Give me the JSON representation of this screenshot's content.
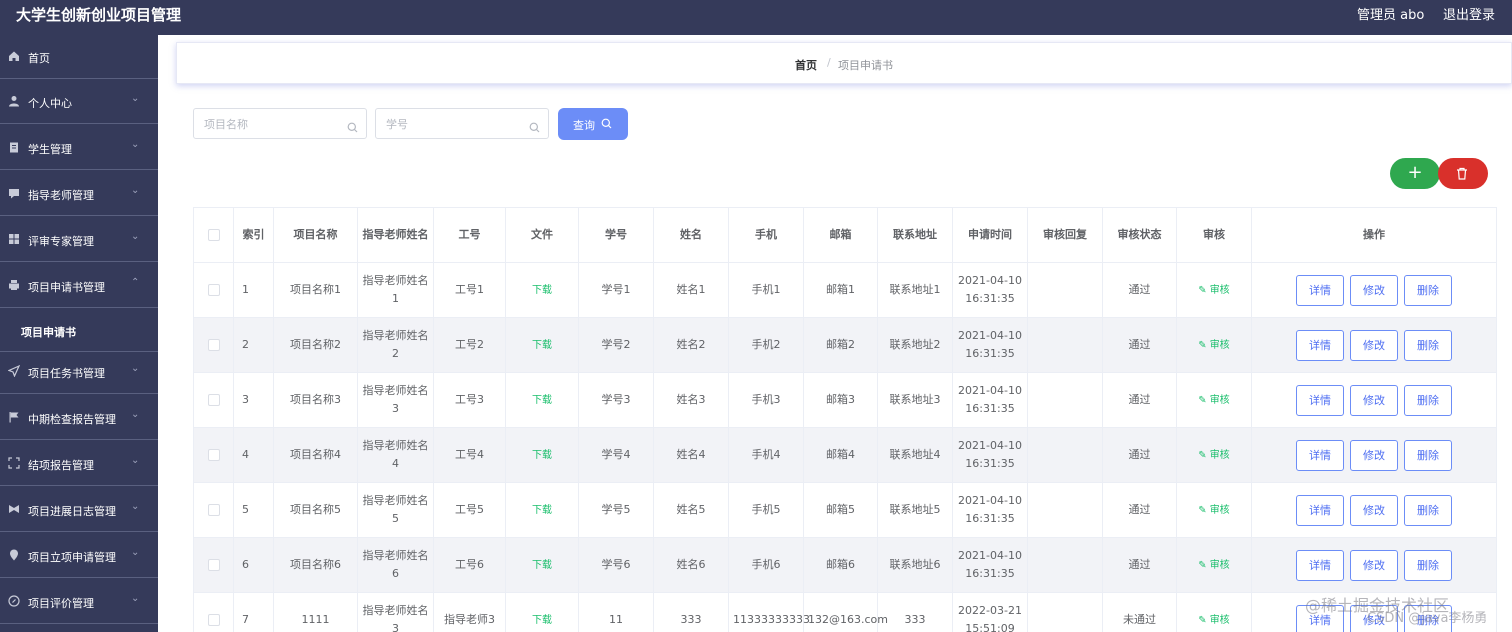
{
  "header": {
    "app_title": "大学生创新创业项目管理",
    "admin_label": "管理员 abo",
    "logout_label": "退出登录"
  },
  "sidebar": {
    "items": [
      {
        "label": "首页",
        "icon": "home-icon"
      },
      {
        "label": "个人中心",
        "icon": "user-icon"
      },
      {
        "label": "学生管理",
        "icon": "clipboard-icon"
      },
      {
        "label": "指导老师管理",
        "icon": "chat-icon"
      },
      {
        "label": "评审专家管理",
        "icon": "grid-icon"
      },
      {
        "label": "项目申请书管理",
        "icon": "printer-icon"
      },
      {
        "label": "项目申请书",
        "icon": ""
      },
      {
        "label": "项目任务书管理",
        "icon": "send-icon"
      },
      {
        "label": "中期检查报告管理",
        "icon": "flag-icon"
      },
      {
        "label": "结项报告管理",
        "icon": "frame-icon"
      },
      {
        "label": "项目进展日志管理",
        "icon": "bow-icon"
      },
      {
        "label": "项目立项申请管理",
        "icon": "location-icon"
      },
      {
        "label": "项目评价管理",
        "icon": "compass-icon"
      }
    ]
  },
  "breadcrumb": {
    "home": "首页",
    "separator": "/",
    "current": "项目申请书"
  },
  "search": {
    "project_name_placeholder": "项目名称",
    "student_id_placeholder": "学号",
    "query_label": "查询"
  },
  "actions": {
    "add_label": "+"
  },
  "table": {
    "headers": [
      "索引",
      "项目名称",
      "指导老师姓名",
      "工号",
      "文件",
      "学号",
      "姓名",
      "手机",
      "邮箱",
      "联系地址",
      "申请时间",
      "审核回复",
      "审核状态",
      "审核",
      "操作"
    ],
    "rows": [
      {
        "index": "1",
        "project": "项目名称1",
        "teacher": "指导老师姓名1",
        "job_no": "工号1",
        "file": "下载",
        "student_id": "学号1",
        "name": "姓名1",
        "phone": "手机1",
        "email": "邮箱1",
        "address": "联系地址1",
        "apply_time": "2021-04-10 16:31:35",
        "reply": "",
        "status": "通过",
        "audit": "审核"
      },
      {
        "index": "2",
        "project": "项目名称2",
        "teacher": "指导老师姓名2",
        "job_no": "工号2",
        "file": "下载",
        "student_id": "学号2",
        "name": "姓名2",
        "phone": "手机2",
        "email": "邮箱2",
        "address": "联系地址2",
        "apply_time": "2021-04-10 16:31:35",
        "reply": "",
        "status": "通过",
        "audit": "审核"
      },
      {
        "index": "3",
        "project": "项目名称3",
        "teacher": "指导老师姓名3",
        "job_no": "工号3",
        "file": "下载",
        "student_id": "学号3",
        "name": "姓名3",
        "phone": "手机3",
        "email": "邮箱3",
        "address": "联系地址3",
        "apply_time": "2021-04-10 16:31:35",
        "reply": "",
        "status": "通过",
        "audit": "审核"
      },
      {
        "index": "4",
        "project": "项目名称4",
        "teacher": "指导老师姓名4",
        "job_no": "工号4",
        "file": "下载",
        "student_id": "学号4",
        "name": "姓名4",
        "phone": "手机4",
        "email": "邮箱4",
        "address": "联系地址4",
        "apply_time": "2021-04-10 16:31:35",
        "reply": "",
        "status": "通过",
        "audit": "审核"
      },
      {
        "index": "5",
        "project": "项目名称5",
        "teacher": "指导老师姓名5",
        "job_no": "工号5",
        "file": "下载",
        "student_id": "学号5",
        "name": "姓名5",
        "phone": "手机5",
        "email": "邮箱5",
        "address": "联系地址5",
        "apply_time": "2021-04-10 16:31:35",
        "reply": "",
        "status": "通过",
        "audit": "审核"
      },
      {
        "index": "6",
        "project": "项目名称6",
        "teacher": "指导老师姓名6",
        "job_no": "工号6",
        "file": "下载",
        "student_id": "学号6",
        "name": "姓名6",
        "phone": "手机6",
        "email": "邮箱6",
        "address": "联系地址6",
        "apply_time": "2021-04-10 16:31:35",
        "reply": "",
        "status": "通过",
        "audit": "审核"
      },
      {
        "index": "7",
        "project": "1111",
        "teacher": "指导老师姓名3",
        "job_no": "指导老师3",
        "file": "下载",
        "student_id": "11",
        "name": "333",
        "phone": "11333333333",
        "email": "132@163.com",
        "address": "333",
        "apply_time": "2022-03-21 15:51:09",
        "reply": "",
        "status": "未通过",
        "audit": "审核"
      }
    ],
    "op_labels": {
      "detail": "详情",
      "edit": "修改",
      "delete": "删除"
    }
  },
  "watermark": {
    "line1": "@稀土掘金技术社区",
    "line2": "CSDN @java李杨勇"
  },
  "colors": {
    "sidebar_bg": "#353a5a",
    "primary": "#6c8df7",
    "success": "#2fa84f",
    "danger": "#d9302b",
    "link_green": "#19be6b"
  }
}
